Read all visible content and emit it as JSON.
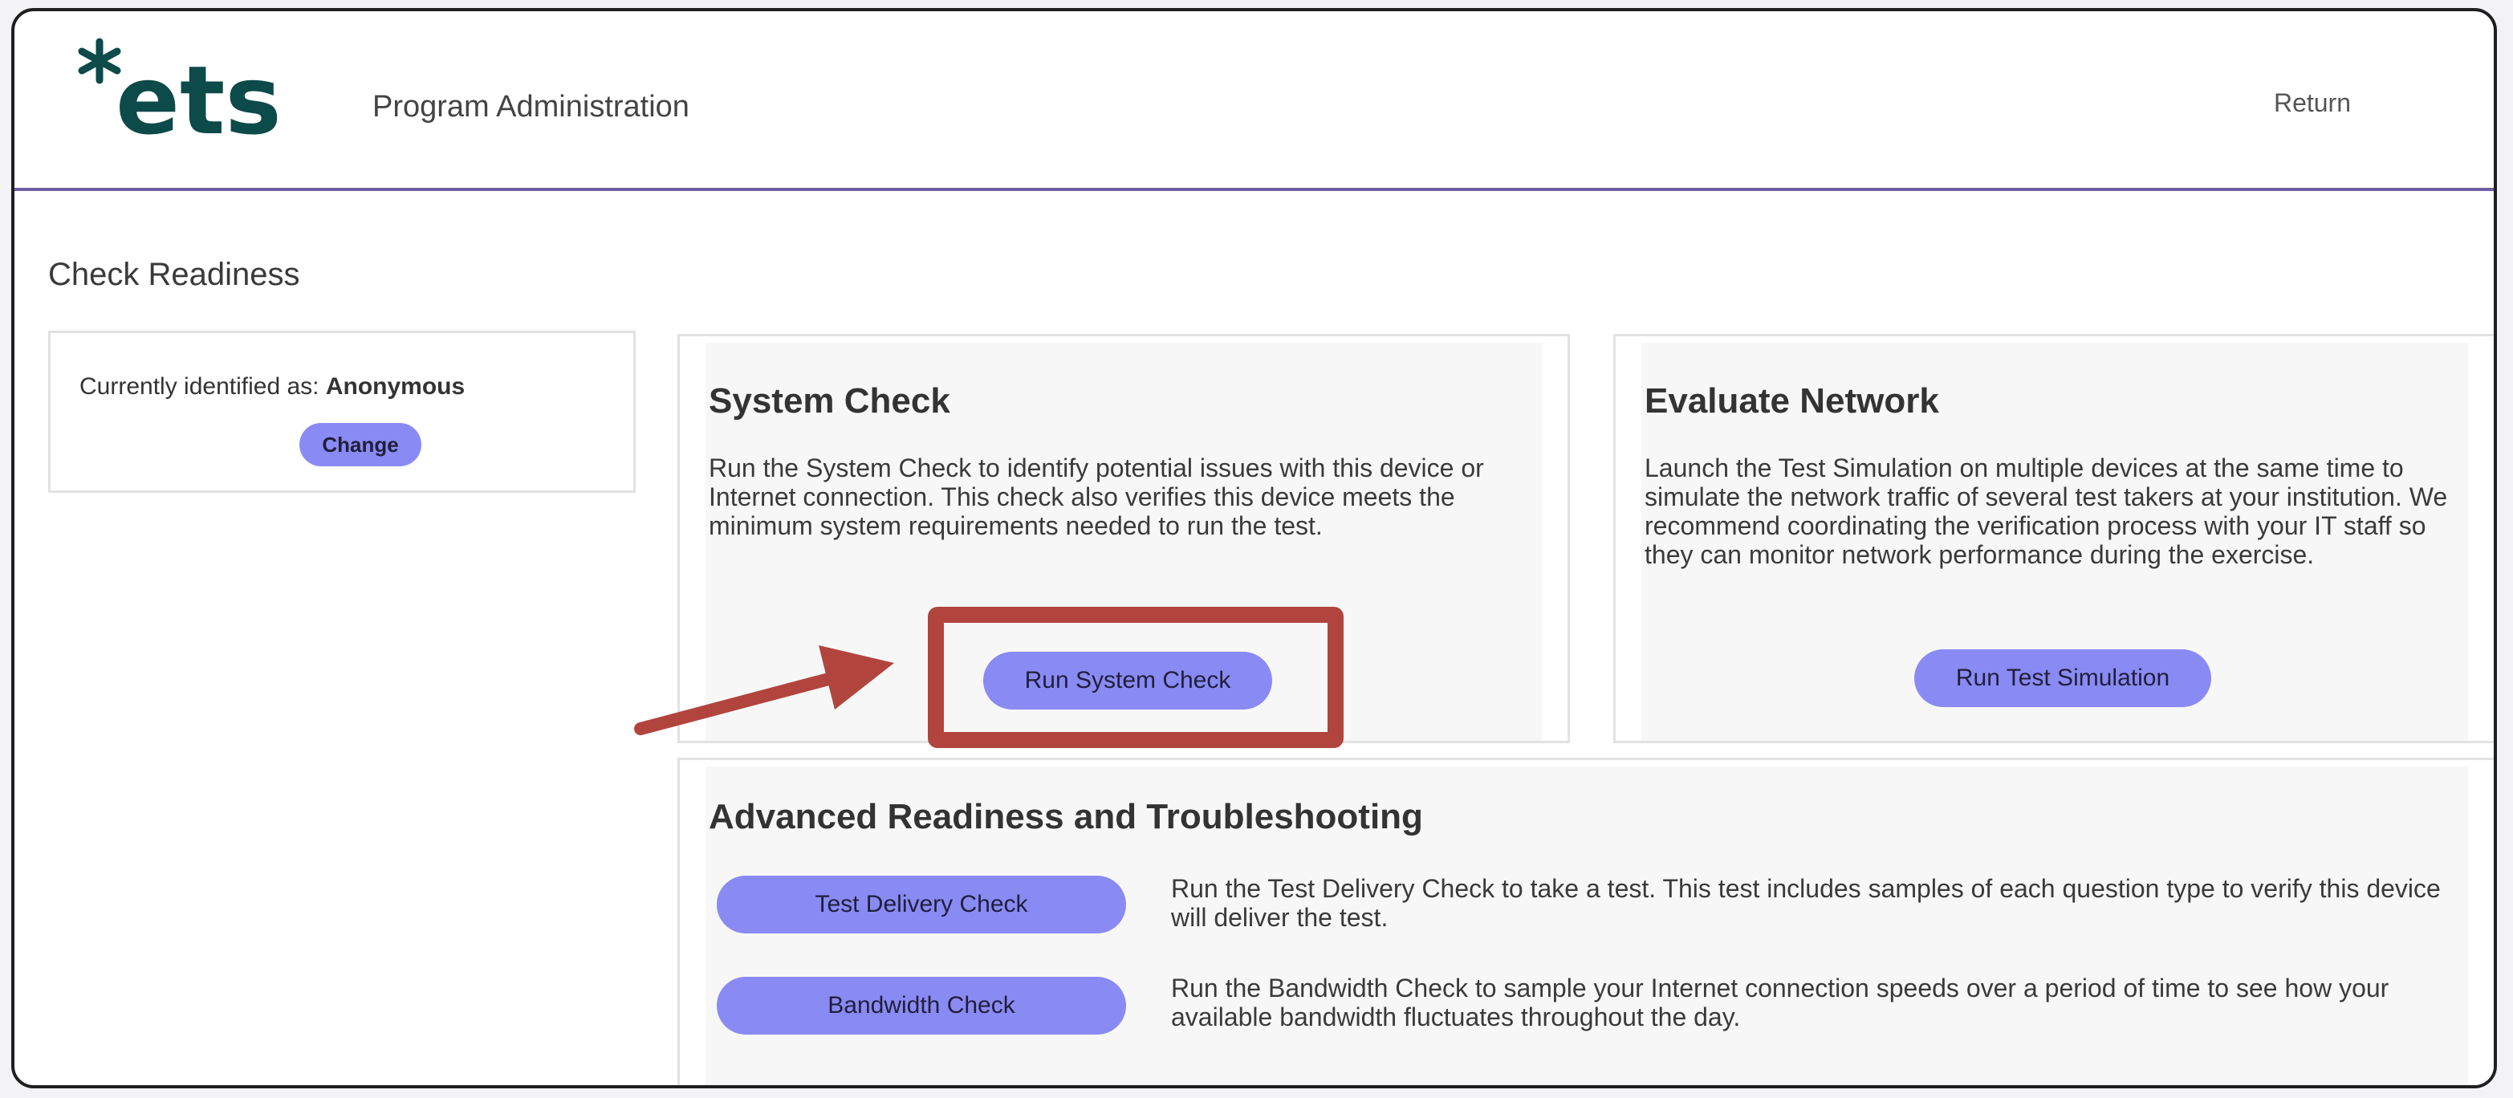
{
  "header": {
    "logo_text": "*ets",
    "app_title": "Program Administration",
    "return_label": "Return"
  },
  "page": {
    "title": "Check Readiness"
  },
  "identity": {
    "prefix": "Currently identified as:",
    "name": "Anonymous",
    "change_label": "Change"
  },
  "system_check": {
    "heading": "System Check",
    "description": "Run the System Check to identify potential issues with this device or Internet connection. This check also verifies this device meets the minimum system requirements needed to run the test.",
    "button_label": "Run System Check"
  },
  "evaluate_network": {
    "heading": "Evaluate Network",
    "description": "Launch the Test Simulation on multiple devices at the same time to simulate the network traffic of several test takers at your institution. We recommend coordinating the verification process with your IT staff so they can monitor network performance during the exercise.",
    "button_label": "Run Test Simulation"
  },
  "advanced": {
    "heading": "Advanced Readiness and Troubleshooting",
    "items": [
      {
        "button_label": "Test Delivery Check",
        "description": "Run the Test Delivery Check to take a test. This test includes samples of each question type to verify this device will deliver the test."
      },
      {
        "button_label": "Bandwidth Check",
        "description": "Run the Bandwidth Check to sample your Internet connection speeds over a period of time to see how your available bandwidth fluctuates throughout the day."
      }
    ]
  },
  "colors": {
    "brand_dark": "#0d4a4a",
    "button": "#8a8af5",
    "annotation": "#b2443e",
    "header_rule": "#6e5fa3"
  },
  "icons": {
    "annotation_arrow": "arrow-right-icon"
  }
}
